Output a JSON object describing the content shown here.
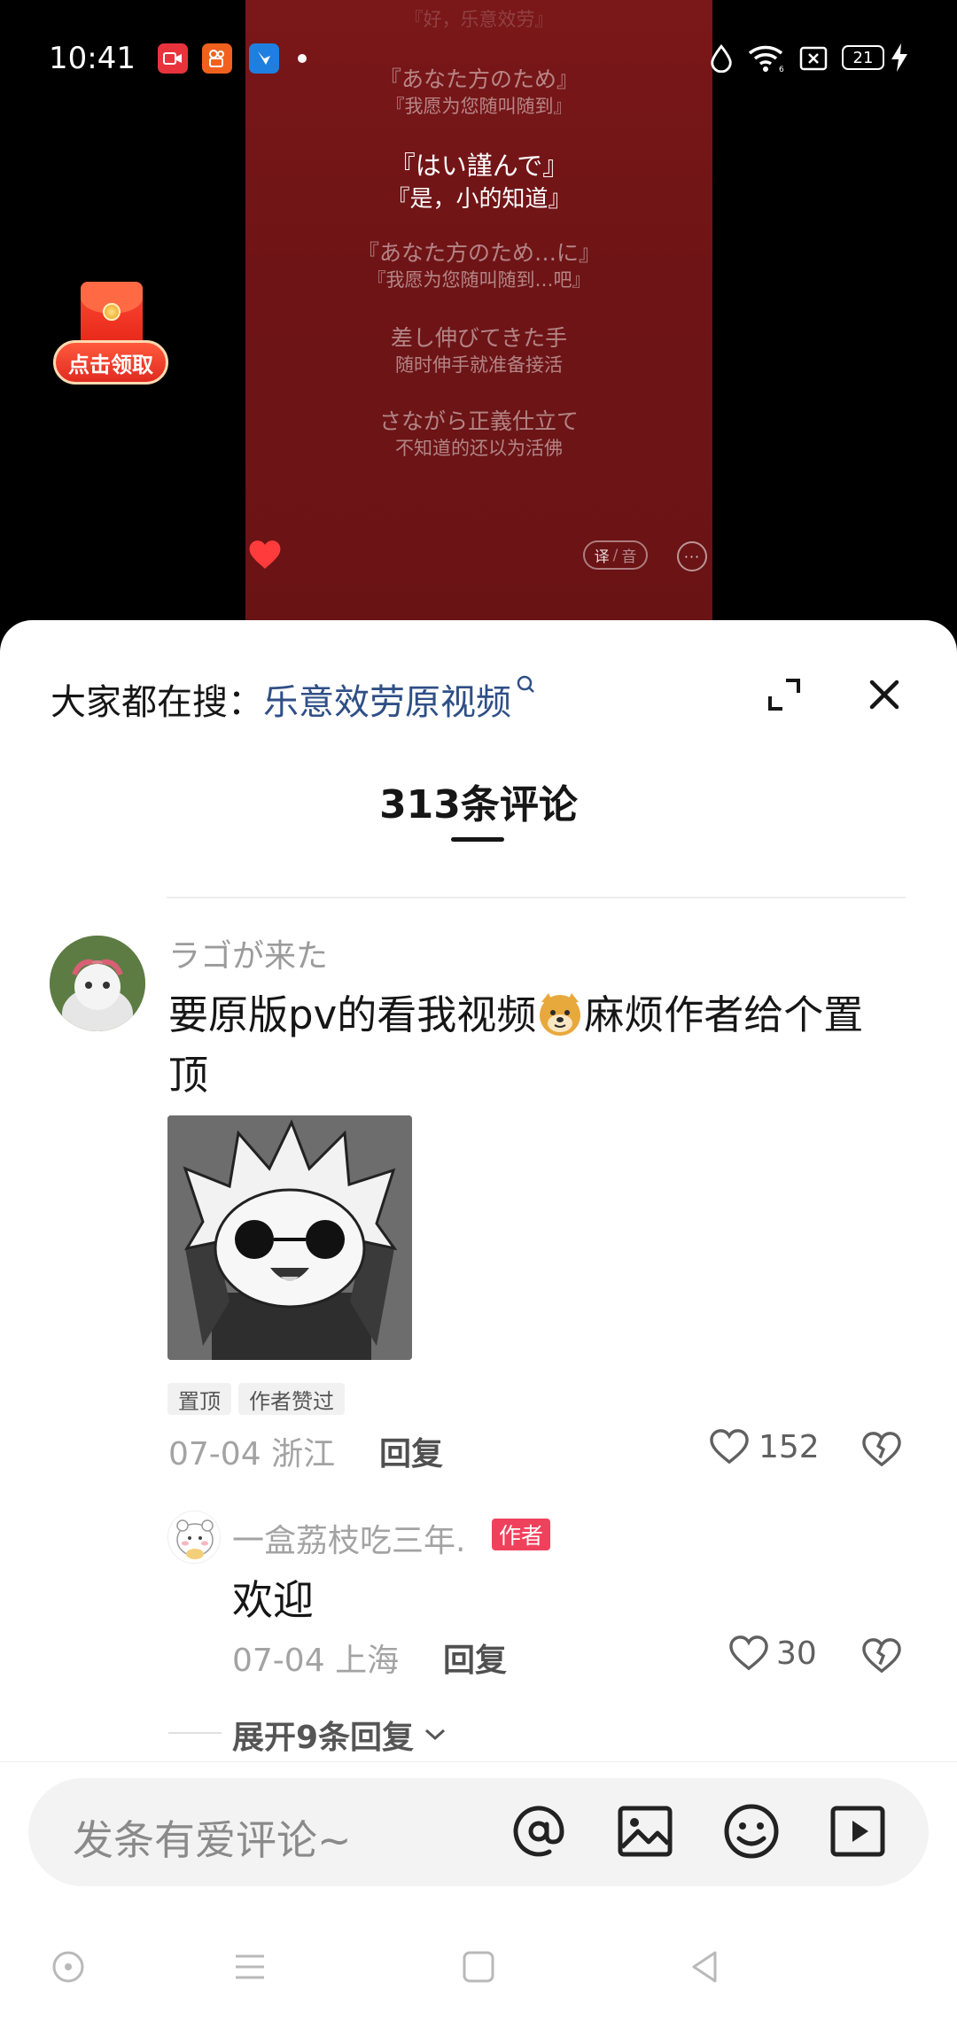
{
  "status_bar": {
    "time": "10:41",
    "battery": "21"
  },
  "lyrics": [
    {
      "text": "『好，乐意效劳』",
      "kind": "zh",
      "state": "dim"
    },
    {
      "text": "『あなた方のため』",
      "kind": "ja",
      "state": "dim"
    },
    {
      "text": "『我愿为您随叫随到』",
      "kind": "zh",
      "state": "dim"
    },
    {
      "text": "『はい謹んで』",
      "kind": "ja",
      "state": "active"
    },
    {
      "text": "『是，小的知道』",
      "kind": "zh",
      "state": "active"
    },
    {
      "text": "『あなた方のため…に』",
      "kind": "ja",
      "state": "dim"
    },
    {
      "text": "『我愿为您随叫随到…吧』",
      "kind": "zh",
      "state": "dim"
    },
    {
      "text": "差し伸びてきた手",
      "kind": "ja",
      "state": "dim"
    },
    {
      "text": "随时伸手就准备接活",
      "kind": "zh",
      "state": "dim"
    },
    {
      "text": "さながら正義仕立て",
      "kind": "ja",
      "state": "dim"
    },
    {
      "text": "不知道的还以为活佛",
      "kind": "zh",
      "state": "dim"
    }
  ],
  "player": {
    "translate_label": "译",
    "audio_label": "音"
  },
  "red_envelope": {
    "label": "点击领取"
  },
  "sheet": {
    "search_prefix": "大家都在搜：",
    "search_keyword": "乐意效劳原视频",
    "comment_count": "313条评论"
  },
  "comment": {
    "username": "ラゴが来た",
    "text_before": "要原版pv的看我视频",
    "text_after": "麻烦作者给个置顶",
    "tags": [
      "置顶",
      "作者赞过"
    ],
    "date": "07-04",
    "location": "浙江",
    "reply_label": "回复",
    "likes": "152"
  },
  "reply": {
    "username": "一盒荔枝吃三年.",
    "badge": "作者",
    "text": "欢迎",
    "date": "07-04",
    "location": "上海",
    "reply_label": "回复",
    "likes": "30"
  },
  "expand_replies_label": "展开9条回复",
  "input": {
    "placeholder": "发条有爱评论~"
  },
  "icons": [
    "at-icon",
    "image-icon",
    "emoji-icon",
    "video-icon"
  ],
  "colors": {
    "lyric_bg": "#6e1416",
    "accent_red": "#f0415c",
    "search_link": "#2f4f86"
  }
}
